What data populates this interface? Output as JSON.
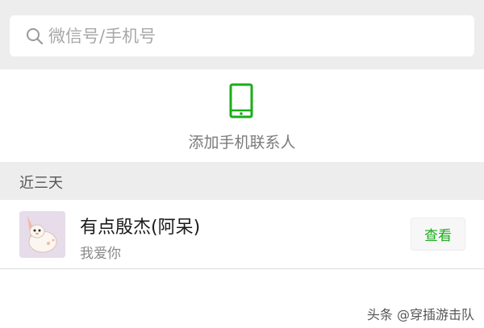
{
  "search": {
    "placeholder": "微信号/手机号",
    "icon": "search-icon"
  },
  "add_phone_contact": {
    "label": "添加手机联系人",
    "icon": "phone-icon",
    "icon_color": "#1aad19"
  },
  "section": {
    "title": "近三天"
  },
  "contacts": [
    {
      "name": "有点殷杰(阿呆)",
      "note": "我爱你",
      "action_label": "查看"
    }
  ],
  "watermark": {
    "text": "头条 @穿插游击队"
  },
  "colors": {
    "accent": "#1aad19",
    "background_gray": "#ededed"
  }
}
